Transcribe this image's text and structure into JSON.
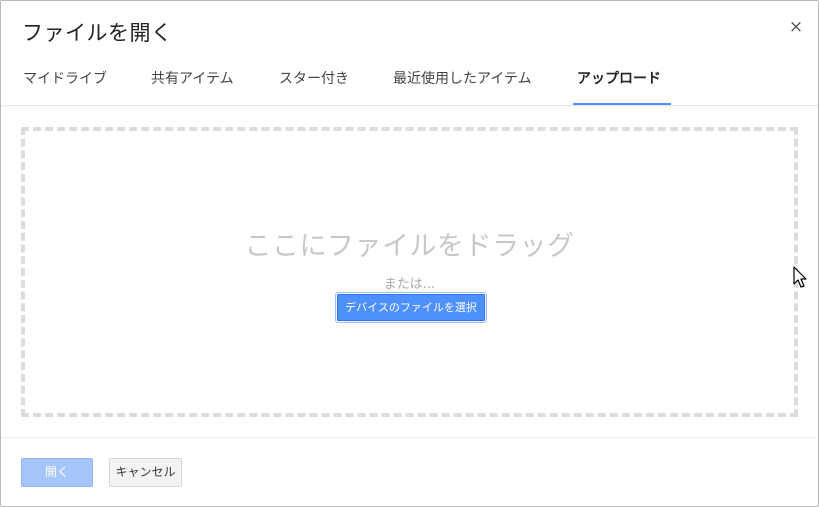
{
  "dialog": {
    "title": "ファイルを開く",
    "close_icon": "×"
  },
  "tabs": [
    {
      "label": "マイドライブ",
      "active": false
    },
    {
      "label": "共有アイテム",
      "active": false
    },
    {
      "label": "スター付き",
      "active": false
    },
    {
      "label": "最近使用したアイテム",
      "active": false
    },
    {
      "label": "アップロード",
      "active": true
    }
  ],
  "upload": {
    "drag_text": "ここにファイルをドラッグ",
    "or_text": "または...",
    "select_button": "デバイスのファイルを選択"
  },
  "footer": {
    "open_button": "開く",
    "cancel_button": "キャンセル"
  },
  "colors": {
    "accent": "#4d90fe",
    "open_disabled": "#a6c5fb"
  },
  "icons": {
    "close": "close-icon",
    "cursor": "mouse-cursor-icon"
  }
}
